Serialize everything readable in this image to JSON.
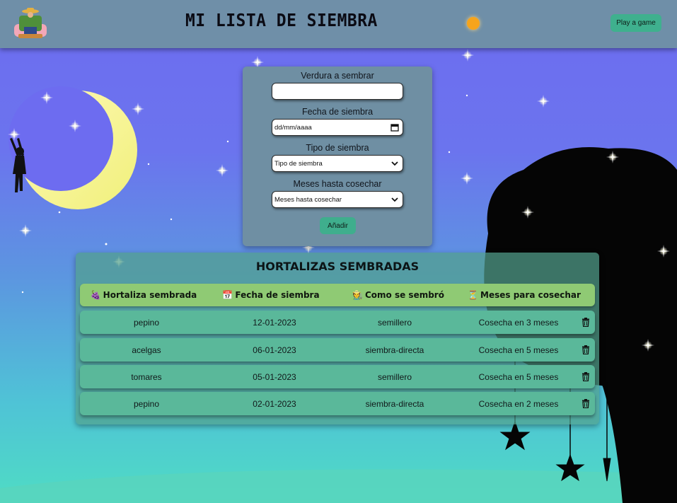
{
  "header": {
    "title": "MI LISTA DE SIEMBRA",
    "play_label": "Play a game"
  },
  "form": {
    "vegetable_label": "Verdura a sembrar",
    "vegetable_value": "",
    "date_label": "Fecha de siembra",
    "date_placeholder": "dd/mm/aaaa",
    "type_label": "Tipo de siembra",
    "type_selected": "Tipo de siembra",
    "months_label": "Meses hasta cosechar",
    "months_selected": "Meses hasta cosechar",
    "add_label": "Añadir"
  },
  "table": {
    "title": "HORTALIZAS SEMBRADAS",
    "headers": [
      {
        "icon": "🍇",
        "label": "Hortaliza sembrada"
      },
      {
        "icon": "📅",
        "label": "Fecha de siembra"
      },
      {
        "icon": "🧑‍🌾",
        "label": "Como se sembró"
      },
      {
        "icon": "⏳",
        "label": "Meses para cosechar"
      }
    ],
    "rows": [
      {
        "vegetable": "pepino",
        "date": "12-01-2023",
        "method": "semillero",
        "harvest": "Cosecha en 3 meses"
      },
      {
        "vegetable": "acelgas",
        "date": "06-01-2023",
        "method": "siembra-directa",
        "harvest": "Cosecha en 5 meses"
      },
      {
        "vegetable": "tomares",
        "date": "05-01-2023",
        "method": "semillero",
        "harvest": "Cosecha en 5 meses"
      },
      {
        "vegetable": "pepino",
        "date": "02-01-2023",
        "method": "siembra-directa",
        "harvest": "Cosecha en 2 meses"
      }
    ]
  },
  "colors": {
    "header_bg": "#6f8fa8",
    "button_green": "#3fb08e",
    "table_head_green": "#8fca74",
    "row_green": "#5ab89a"
  }
}
